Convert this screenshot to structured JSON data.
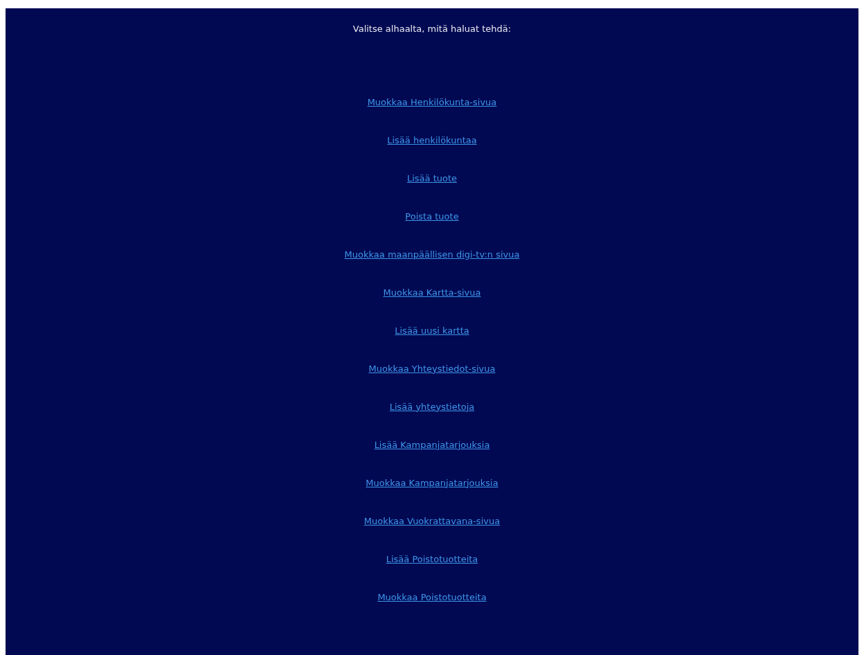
{
  "heading": "Valitse alhaalta, mitä haluat tehdä:",
  "links": [
    {
      "label": "Muokkaa Henkilökunta-sivua"
    },
    {
      "label": "Lisää henkilökuntaa"
    },
    {
      "label": "Lisää tuote"
    },
    {
      "label": "Poista tuote"
    },
    {
      "label": "Muokkaa maanpäällisen digi-tv:n sivua"
    },
    {
      "label": "Muokkaa Kartta-sivua"
    },
    {
      "label": "Lisää uusi kartta"
    },
    {
      "label": "Muokkaa Yhteystiedot-sivua"
    },
    {
      "label": "Lisää yhteystietoja"
    },
    {
      "label": "Lisää Kampanjatarjouksia"
    },
    {
      "label": "Muokkaa Kampanjatarjouksia"
    },
    {
      "label": "Muokkaa Vuokrattavana-sivua"
    },
    {
      "label": "Lisää Poistotuotteita"
    },
    {
      "label": "Muokkaa Poistotuotteita"
    }
  ]
}
